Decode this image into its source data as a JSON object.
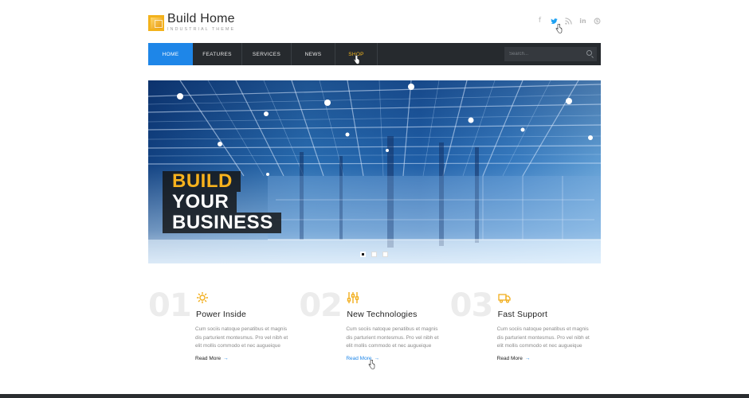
{
  "header": {
    "logo_title": "Build Home",
    "logo_subtitle": "INDUSTRIAL THEME",
    "social": [
      {
        "name": "facebook-icon",
        "glyph": "f"
      },
      {
        "name": "twitter-icon",
        "glyph": "🐦"
      },
      {
        "name": "rss-icon",
        "glyph": "◠"
      },
      {
        "name": "linkedin-icon",
        "glyph": "in"
      },
      {
        "name": "skype-icon",
        "glyph": "S"
      }
    ]
  },
  "nav": {
    "items": [
      {
        "label": "HOME"
      },
      {
        "label": "FEATURES"
      },
      {
        "label": "SERVICES"
      },
      {
        "label": "NEWS"
      },
      {
        "label": "SHOP"
      }
    ],
    "search_placeholder": "Search..."
  },
  "hero": {
    "line1": "BUILD",
    "line2": "YOUR",
    "line3": "BUSINESS",
    "active_slide": 1,
    "slide_count": 3
  },
  "features": [
    {
      "number": "01",
      "icon": "gear-icon",
      "title": "Power Inside",
      "text": "Cum sociis natoque penatibus et magnis dis parturient montesmus. Pro vel nibh et elit mollis commodo et nec augueique",
      "more": "Read More"
    },
    {
      "number": "02",
      "icon": "sliders-icon",
      "title": "New Technologies",
      "text": "Cum sociis natoque penatibus et magnis dis parturient montesmus. Pro vel nibh et elit mollis commodo et nec augueique",
      "more": "Read More"
    },
    {
      "number": "03",
      "icon": "truck-icon",
      "title": "Fast Support",
      "text": "Cum sociis natoque penatibus et magnis dis parturient montesmus. Pro vel nibh et elit mollis commodo et nec augueique",
      "more": "Read More"
    }
  ],
  "colors": {
    "accent_blue": "#1e86e8",
    "accent_yellow": "#f2b51f",
    "nav_bg": "#262a2e"
  }
}
